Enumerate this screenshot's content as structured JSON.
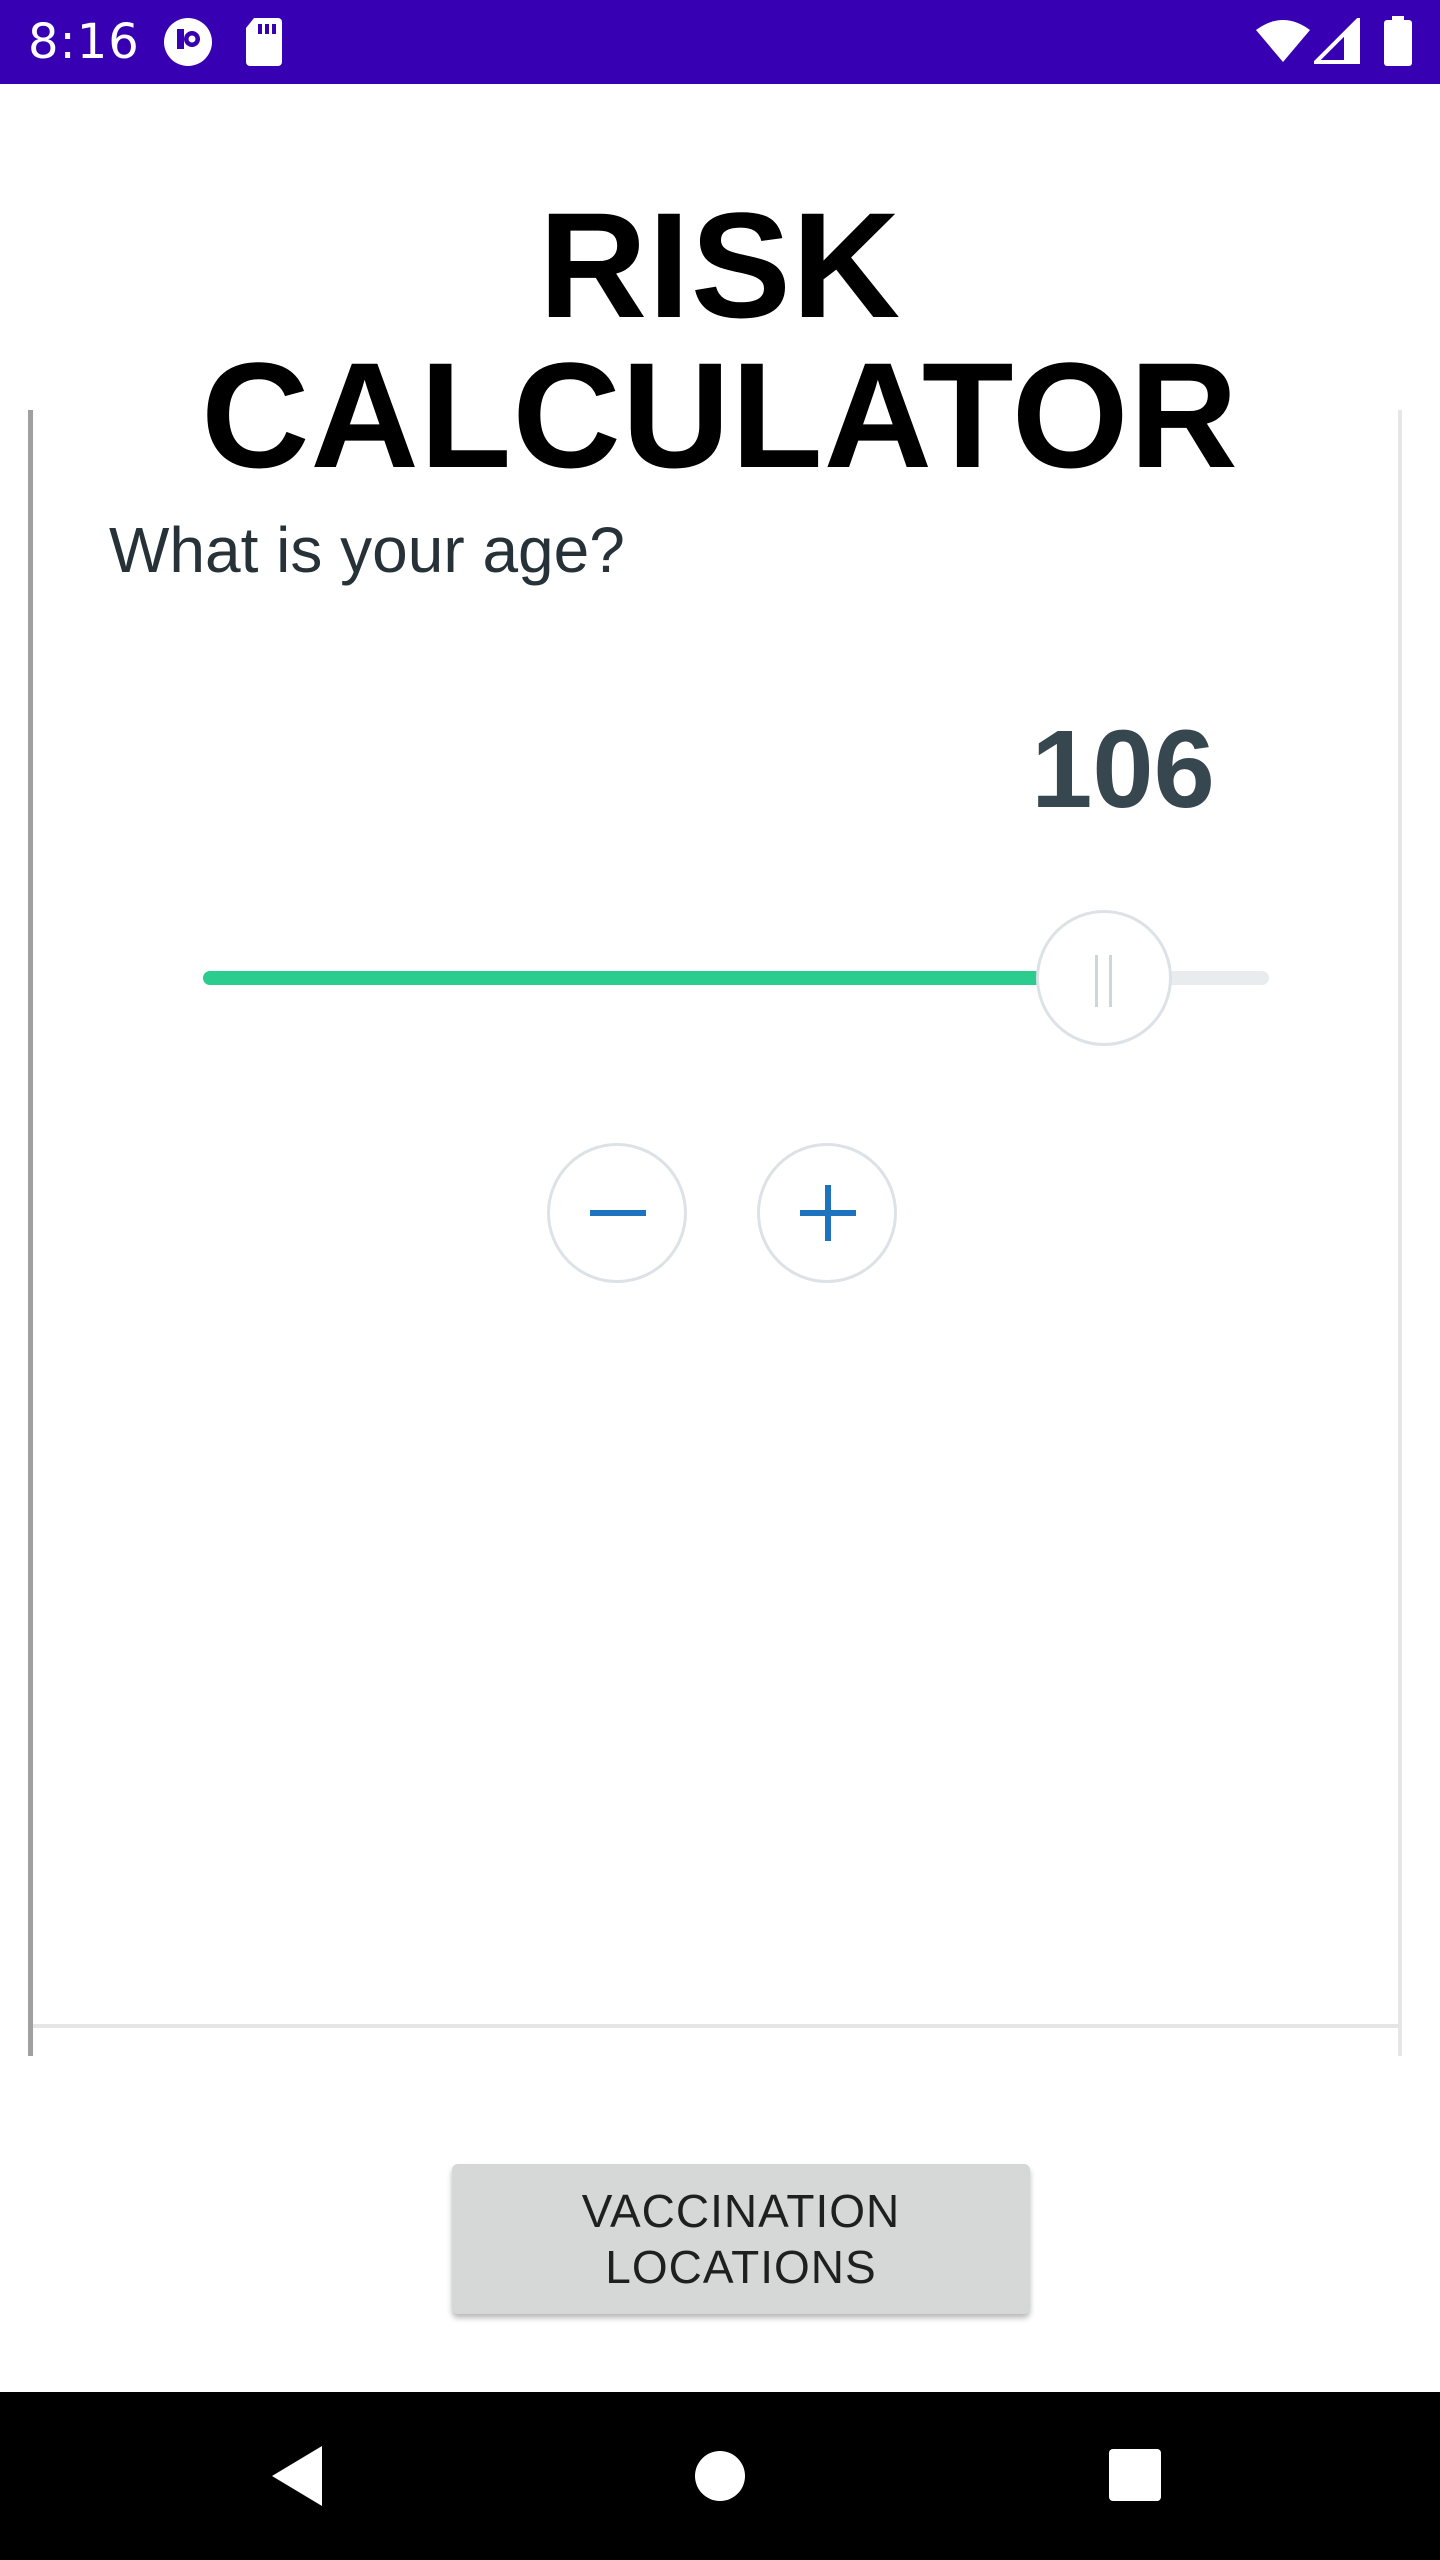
{
  "status_bar": {
    "time": "8:16",
    "background": "#3700b3",
    "icons": [
      "app-notification-icon",
      "sd-card-icon",
      "wifi-icon",
      "cell-signal-icon",
      "battery-icon"
    ]
  },
  "title": "RISK CALCULATOR",
  "question_card": {
    "question": "What is your age?",
    "age_value": "106",
    "slider": {
      "level_fraction": 0.845,
      "fill_color": "#2bcc8e",
      "track_color": "#e8ecef"
    },
    "decrement_icon": "minus-icon",
    "increment_icon": "plus-icon",
    "accent_color": "#1e73be"
  },
  "vaccination_button": {
    "label": "VACCINATION LOCATIONS"
  },
  "nav_bar": {
    "back_icon": "back-triangle-icon",
    "home_icon": "home-circle-icon",
    "recents_icon": "recents-square-icon"
  }
}
